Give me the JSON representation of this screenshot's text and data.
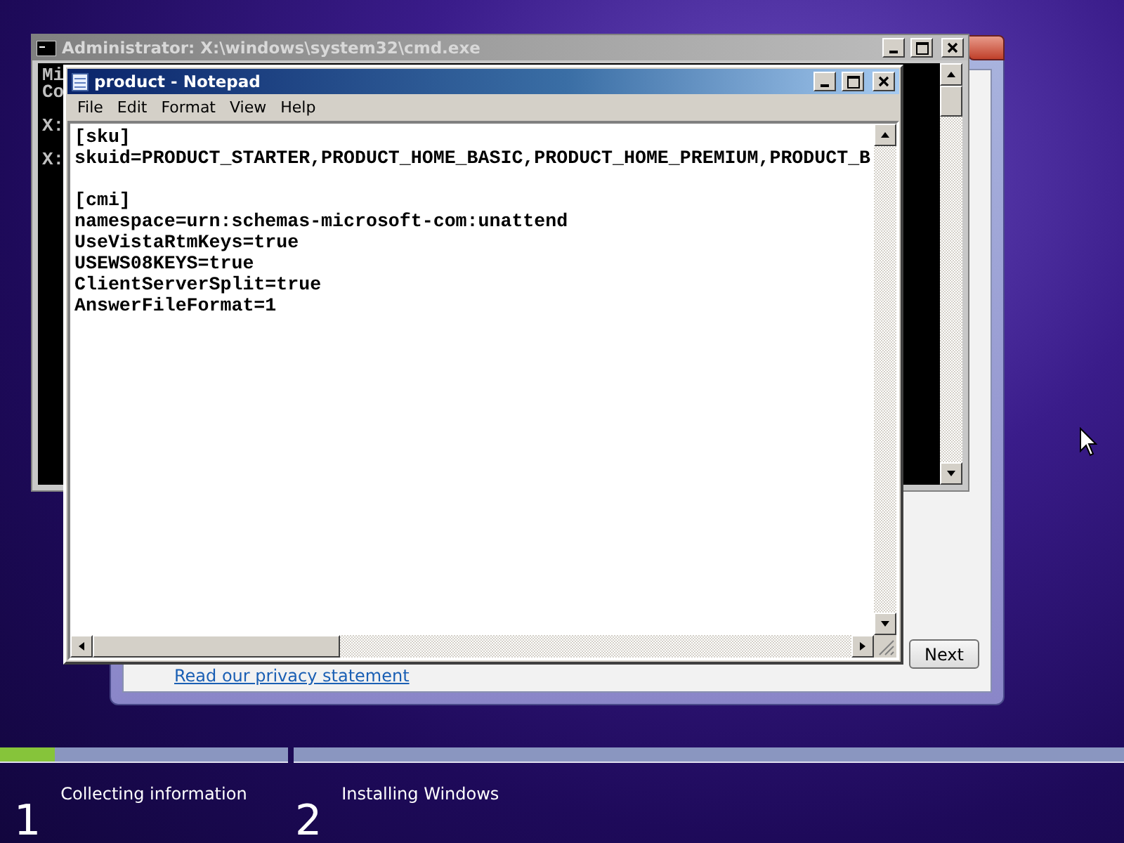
{
  "setup_window": {
    "link": "Read our privacy statement",
    "next_button": "Next"
  },
  "cmd_window": {
    "title": "Administrator: X:\\windows\\system32\\cmd.exe",
    "lines": [
      "Mi",
      "Co",
      "X:",
      "X:"
    ]
  },
  "notepad": {
    "title": "product - Notepad",
    "menu": [
      "File",
      "Edit",
      "Format",
      "View",
      "Help"
    ],
    "blocks": [
      [
        "[sku]",
        "skuid=PRODUCT_STARTER,PRODUCT_HOME_BASIC,PRODUCT_HOME_PREMIUM,PRODUCT_B"
      ],
      [
        "[cmi]",
        "namespace=urn:schemas-microsoft-com:unattend",
        "UseVistaRtmKeys=true",
        "USEWS08KEYS=true",
        "ClientServerSplit=true",
        "AnswerFileFormat=1"
      ]
    ]
  },
  "steps": [
    {
      "number": "1",
      "label": "Collecting information",
      "level": 0.19
    },
    {
      "number": "2",
      "label": "Installing Windows"
    }
  ]
}
